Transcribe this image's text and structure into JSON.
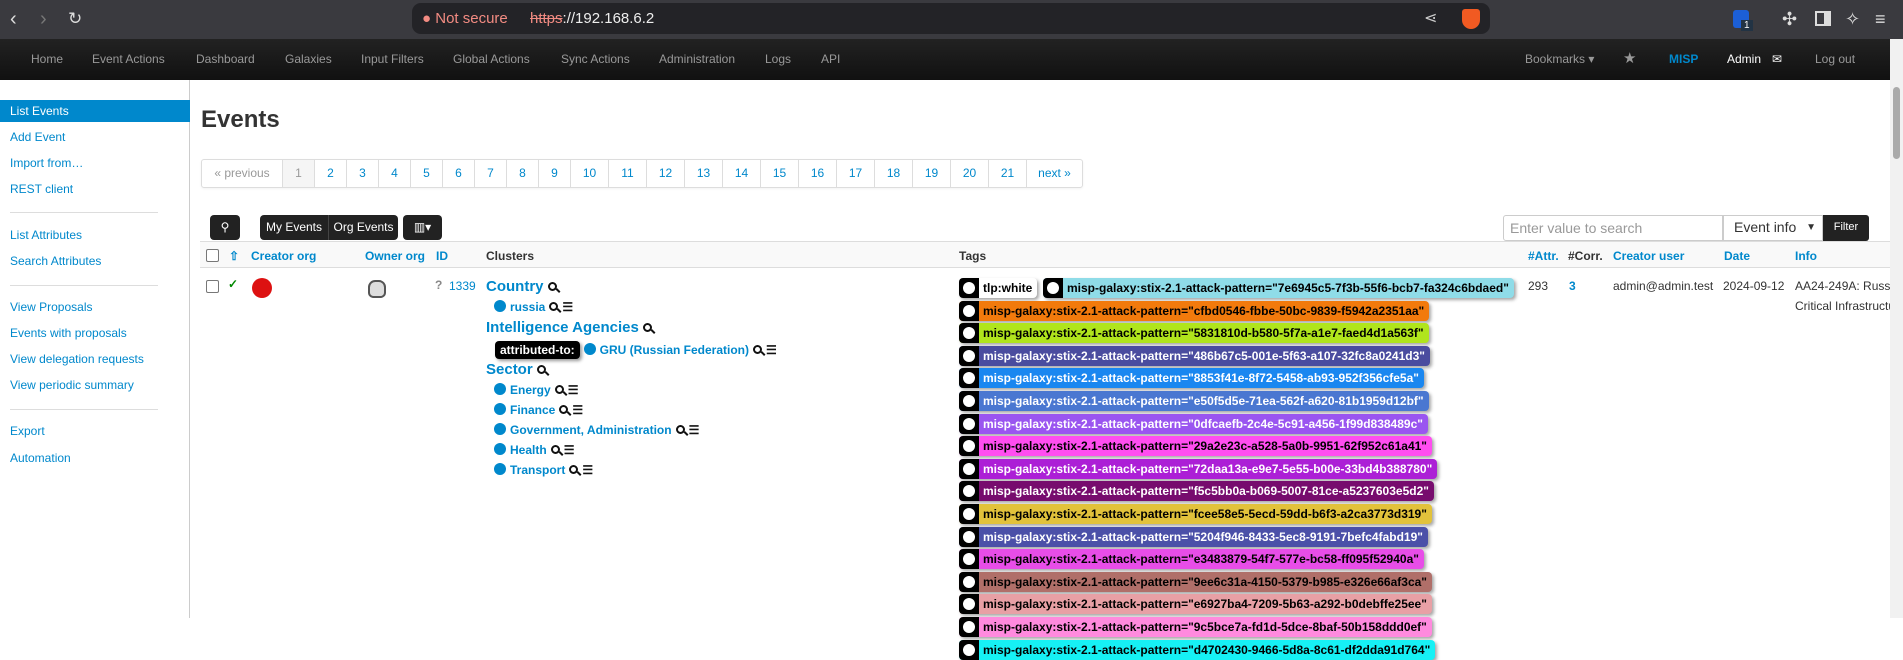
{
  "browser": {
    "not_secure": "Not secure",
    "url_scheme": "https",
    "url_rest": "://192.168.6.2",
    "ext_badge": "1"
  },
  "nav": {
    "items": [
      "Home",
      "Event Actions",
      "Dashboard",
      "Galaxies",
      "Input Filters",
      "Global Actions",
      "Sync Actions",
      "Administration",
      "Logs",
      "API"
    ],
    "bookmarks": "Bookmarks ▾",
    "misp": "MISP",
    "admin": "Admin",
    "logout": "Log out"
  },
  "sidebar": {
    "items": [
      "List Events",
      "Add Event",
      "Import from…",
      "REST client",
      "List Attributes",
      "Search Attributes",
      "View Proposals",
      "Events with proposals",
      "View delegation requests",
      "View periodic summary",
      "Export",
      "Automation"
    ]
  },
  "page_title": "Events",
  "pager": [
    "« previous",
    "1",
    "2",
    "3",
    "4",
    "5",
    "6",
    "7",
    "8",
    "9",
    "10",
    "11",
    "12",
    "13",
    "14",
    "15",
    "16",
    "17",
    "18",
    "19",
    "20",
    "21",
    "next »"
  ],
  "toolbar": {
    "my_events": "My Events",
    "org_events": "Org Events",
    "search_placeholder": "Enter value to search",
    "select_value": "Event info",
    "filter": "Filter"
  },
  "columns": {
    "creator_org": "Creator org",
    "owner_org": "Owner org",
    "id": "ID",
    "clusters": "Clusters",
    "tags": "Tags",
    "attr": "#Attr.",
    "corr": "#Corr.",
    "creator_user": "Creator user",
    "date": "Date",
    "info": "Info"
  },
  "row": {
    "id": "1339",
    "attr": "293",
    "corr": "3",
    "creator_user": "admin@admin.test",
    "date": "2024-09-12",
    "info_line1": "AA24-249A: Russ",
    "info_line2": "Critical Infrastructu"
  },
  "clusters": {
    "country": "Country",
    "russia": "russia",
    "intel": "Intelligence Agencies",
    "attributed": "attributed-to:",
    "gru": "GRU (Russian Federation)",
    "sector": "Sector",
    "sectors": [
      "Energy",
      "Finance",
      "Government, Administration",
      "Health",
      "Transport"
    ]
  },
  "tags": [
    {
      "label": "tlp:white",
      "bg": "#ffffff",
      "fg": "#000000"
    },
    {
      "label": "misp-galaxy:stix-2.1-attack-pattern=\"7e6945c5-7f3b-55f6-bcb7-fa324c6bdaed\"",
      "bg": "#8fdce8",
      "fg": "#000000"
    },
    {
      "label": "misp-galaxy:stix-2.1-attack-pattern=\"cfbd0546-fbbe-50bc-9839-f5942a2351aa\"",
      "bg": "#f27a0c",
      "fg": "#000000"
    },
    {
      "label": "misp-galaxy:stix-2.1-attack-pattern=\"5831810d-b580-5f7a-a1e7-faed4d1a563f\"",
      "bg": "#b0e51c",
      "fg": "#000000"
    },
    {
      "label": "misp-galaxy:stix-2.1-attack-pattern=\"486b67c5-001e-5f63-a107-32fc8a0241d3\"",
      "bg": "#4a4c9f",
      "fg": "#ffffff"
    },
    {
      "label": "misp-galaxy:stix-2.1-attack-pattern=\"8853f41e-8f72-5458-ab93-952f356cfe5a\"",
      "bg": "#1a87f0",
      "fg": "#ffffff"
    },
    {
      "label": "misp-galaxy:stix-2.1-attack-pattern=\"e50f5d5e-71ea-562f-a620-81b1959d12bf\"",
      "bg": "#4a77d1",
      "fg": "#ffffff"
    },
    {
      "label": "misp-galaxy:stix-2.1-attack-pattern=\"0dfcaefb-2c4e-5c91-a456-1f99d838489c\"",
      "bg": "#9a55f0",
      "fg": "#ffffff"
    },
    {
      "label": "misp-galaxy:stix-2.1-attack-pattern=\"29a2e23c-a528-5a0b-9951-62f952c61a41\"",
      "bg": "#ff4df0",
      "fg": "#000000"
    },
    {
      "label": "misp-galaxy:stix-2.1-attack-pattern=\"72daa13a-e9e7-5e55-b00e-33bd4b388780\"",
      "bg": "#ac1fd6",
      "fg": "#ffffff"
    },
    {
      "label": "misp-galaxy:stix-2.1-attack-pattern=\"f5c5bb0a-b069-5007-81ce-a5237603e5d2\"",
      "bg": "#770c6e",
      "fg": "#ffffff"
    },
    {
      "label": "misp-galaxy:stix-2.1-attack-pattern=\"fcee58e5-5ecd-59dd-b6f3-a2ca3773d319\"",
      "bg": "#e2c23b",
      "fg": "#000000"
    },
    {
      "label": "misp-galaxy:stix-2.1-attack-pattern=\"5204f946-8433-5ec8-9191-7befc4fabd19\"",
      "bg": "#4b50a8",
      "fg": "#ffffff"
    },
    {
      "label": "misp-galaxy:stix-2.1-attack-pattern=\"e3483879-54f7-577e-bc58-ff095f52940a\"",
      "bg": "#e84de8",
      "fg": "#000000"
    },
    {
      "label": "misp-galaxy:stix-2.1-attack-pattern=\"9ee6c31a-4150-5379-b985-e326e66af3ca\"",
      "bg": "#b06f69",
      "fg": "#000000"
    },
    {
      "label": "misp-galaxy:stix-2.1-attack-pattern=\"e6927ba4-7209-5b63-a292-b0debffe25ee\"",
      "bg": "#e8a0a5",
      "fg": "#000000"
    },
    {
      "label": "misp-galaxy:stix-2.1-attack-pattern=\"9c5bce7a-fd1d-5dce-8baf-50b158ddd0ef\"",
      "bg": "#ff8ade",
      "fg": "#000000"
    },
    {
      "label": "misp-galaxy:stix-2.1-attack-pattern=\"d4702430-9466-5d8a-8c61-df2dda91d764\"",
      "bg": "#16f1f5",
      "fg": "#000000"
    }
  ]
}
